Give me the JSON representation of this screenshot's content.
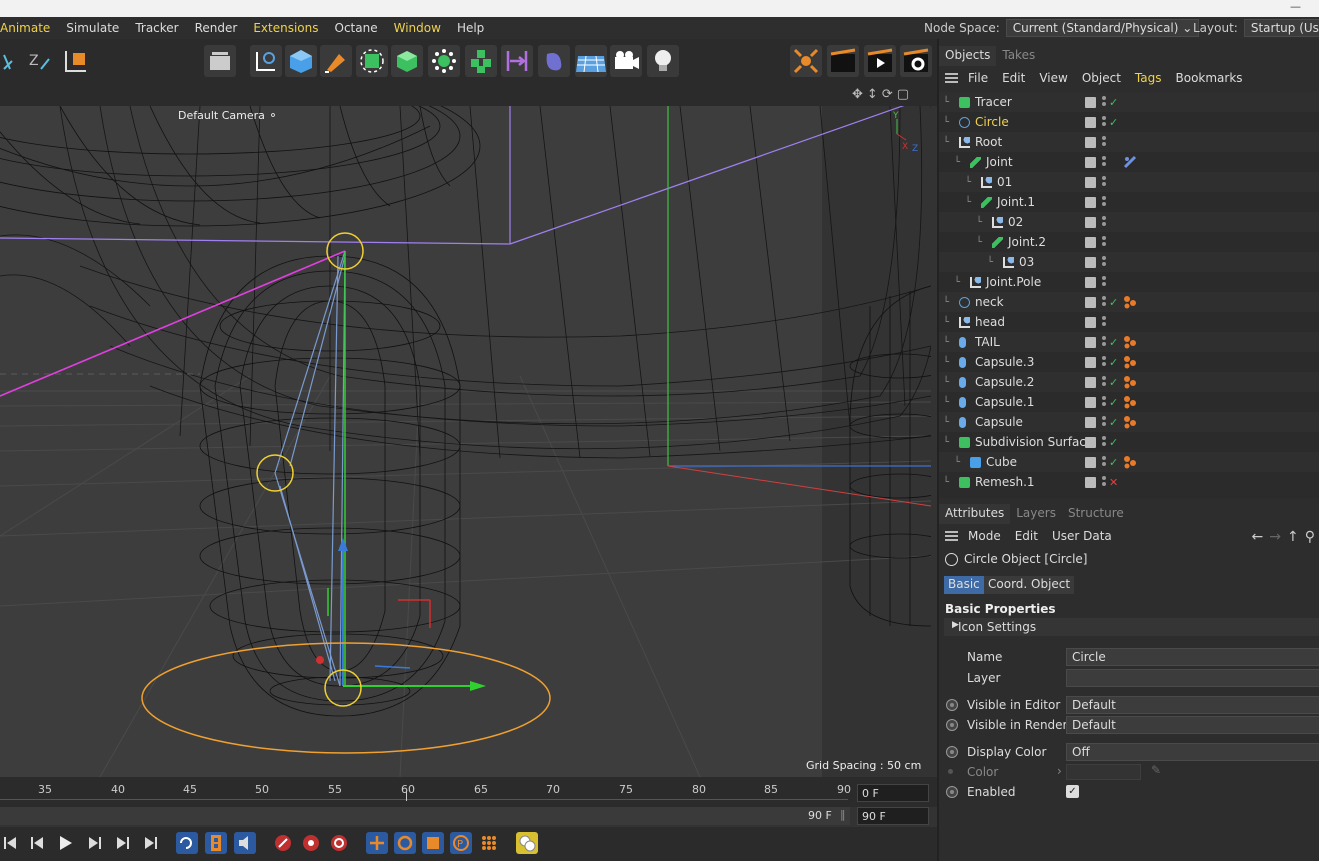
{
  "menubar": {
    "items": [
      {
        "label": "Animate",
        "hl": true
      },
      {
        "label": "Simulate",
        "hl": false
      },
      {
        "label": "Tracker",
        "hl": false
      },
      {
        "label": "Render",
        "hl": false
      },
      {
        "label": "Extensions",
        "hl": true
      },
      {
        "label": "Octane",
        "hl": false
      },
      {
        "label": "Window",
        "hl": true
      },
      {
        "label": "Help",
        "hl": false
      }
    ],
    "node_space_label": "Node Space:",
    "node_space_value": "Current (Standard/Physical)",
    "layout_label": "Layout:",
    "layout_value": "Startup (User)"
  },
  "viewport": {
    "camera_label": "Default Camera",
    "grid_spacing": "Grid Spacing : 50 cm"
  },
  "timeline": {
    "ticks": [
      "35",
      "40",
      "45",
      "50",
      "55",
      "60",
      "65",
      "70",
      "75",
      "80",
      "85",
      "90"
    ],
    "current_frame": "0 F",
    "end_frame_bar": "90 F",
    "end_frame": "90 F"
  },
  "objects_panel": {
    "tabs": [
      "Objects",
      "Takes"
    ],
    "menu": [
      {
        "label": "File",
        "hl": false
      },
      {
        "label": "Edit",
        "hl": false
      },
      {
        "label": "View",
        "hl": false
      },
      {
        "label": "Object",
        "hl": false
      },
      {
        "label": "Tags",
        "hl": true
      },
      {
        "label": "Bookmarks",
        "hl": false
      }
    ],
    "items": [
      {
        "name": "Tracer",
        "icon": "tracer-icon",
        "indent": 0,
        "check": "check",
        "tag": ""
      },
      {
        "name": "Circle",
        "icon": "circle-icon",
        "indent": 0,
        "check": "check",
        "tag": "",
        "selected": true
      },
      {
        "name": "Root",
        "icon": "null-icon",
        "indent": 0,
        "check": "",
        "tag": ""
      },
      {
        "name": "Joint",
        "icon": "joint-icon",
        "indent": 1,
        "check": "",
        "tag": "ik-tag"
      },
      {
        "name": "01",
        "icon": "null-icon",
        "indent": 2,
        "check": "",
        "tag": ""
      },
      {
        "name": "Joint.1",
        "icon": "joint-icon",
        "indent": 2,
        "check": "",
        "tag": ""
      },
      {
        "name": "02",
        "icon": "null-icon",
        "indent": 3,
        "check": "",
        "tag": ""
      },
      {
        "name": "Joint.2",
        "icon": "joint-icon",
        "indent": 3,
        "check": "",
        "tag": ""
      },
      {
        "name": "03",
        "icon": "null-icon",
        "indent": 4,
        "check": "",
        "tag": ""
      },
      {
        "name": "Joint.Pole",
        "icon": "null-icon",
        "indent": 1,
        "check": "",
        "tag": ""
      },
      {
        "name": "neck",
        "icon": "circle-icon",
        "indent": 0,
        "check": "check",
        "tag": "constraint-tag"
      },
      {
        "name": "head",
        "icon": "null-icon",
        "indent": 0,
        "check": "",
        "tag": ""
      },
      {
        "name": "TAIL",
        "icon": "capsule-icon",
        "indent": 0,
        "check": "check",
        "tag": "constraint-tag"
      },
      {
        "name": "Capsule.3",
        "icon": "capsule-icon",
        "indent": 0,
        "check": "check",
        "tag": "constraint-tag"
      },
      {
        "name": "Capsule.2",
        "icon": "capsule-icon",
        "indent": 0,
        "check": "check",
        "tag": "constraint-tag"
      },
      {
        "name": "Capsule.1",
        "icon": "capsule-icon",
        "indent": 0,
        "check": "check",
        "tag": "constraint-tag"
      },
      {
        "name": "Capsule",
        "icon": "capsule-icon",
        "indent": 0,
        "check": "check",
        "tag": "constraint-tag"
      },
      {
        "name": "Subdivision Surface",
        "icon": "subdivision-icon",
        "indent": 0,
        "check": "check",
        "tag": ""
      },
      {
        "name": "Cube",
        "icon": "cube-icon",
        "indent": 1,
        "check": "check",
        "tag": "constraint-tag"
      },
      {
        "name": "Remesh.1",
        "icon": "remesh-icon",
        "indent": 0,
        "check": "x",
        "tag": ""
      }
    ]
  },
  "attributes_panel": {
    "tabs": [
      "Attributes",
      "Layers",
      "Structure"
    ],
    "menu": [
      "Mode",
      "Edit",
      "User Data"
    ],
    "object_title": "Circle Object [Circle]",
    "subtabs": [
      "Basic",
      "Coord.",
      "Object"
    ],
    "section_title": "Basic Properties",
    "icon_settings": "Icon Settings",
    "props": [
      {
        "label": "Name",
        "value": "Circle",
        "radio": false
      },
      {
        "label": "Layer",
        "value": "",
        "radio": false
      },
      {
        "label": "Visible in Editor",
        "value": "Default",
        "radio": true
      },
      {
        "label": "Visible in Renderer",
        "value": "Default",
        "radio": true
      },
      {
        "label": "Display Color",
        "value": "Off",
        "radio": true
      },
      {
        "label": "Color",
        "value": "",
        "radio": true
      },
      {
        "label": "Enabled",
        "value": "",
        "radio": true
      }
    ]
  }
}
